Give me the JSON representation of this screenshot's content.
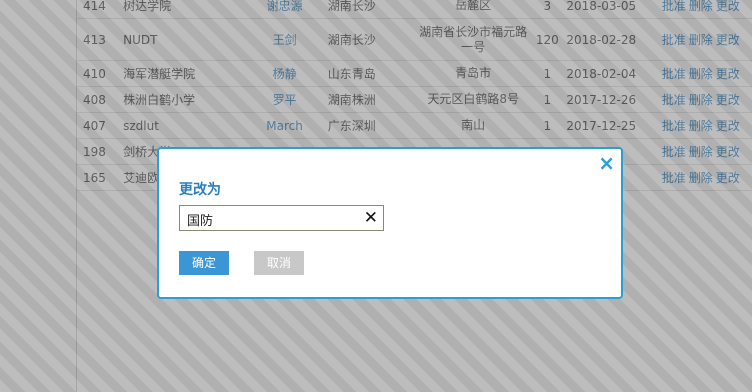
{
  "table": {
    "rows": [
      {
        "id": "414",
        "school": "树达学院",
        "name": "谢忠源",
        "city": "湖南长沙",
        "address": "岳麓区",
        "count": "3",
        "date": "2018-03-05"
      },
      {
        "id": "413",
        "school": "NUDT",
        "name": "王剑",
        "city": "湖南长沙",
        "address": "湖南省长沙市福元路一号",
        "count": "120",
        "date": "2018-02-28",
        "tall": true
      },
      {
        "id": "410",
        "school": "海军潜艇学院",
        "name": "杨静",
        "city": "山东青岛",
        "address": "青岛市",
        "count": "1",
        "date": "2018-02-04"
      },
      {
        "id": "408",
        "school": "株洲白鹤小学",
        "name": "罗平",
        "city": "湖南株洲",
        "address": "天元区白鹤路8号",
        "count": "1",
        "date": "2017-12-26"
      },
      {
        "id": "407",
        "school": "szdlut",
        "name": "March",
        "city": "广东深圳",
        "address": "南山",
        "count": "1",
        "date": "2017-12-25"
      },
      {
        "id": "198",
        "school": "剑桥大学",
        "name": "",
        "city": "",
        "address": "",
        "count": "",
        "date": "-01"
      },
      {
        "id": "165",
        "school": "艾迪欧南",
        "name": "",
        "city": "",
        "address": "",
        "count": "",
        "date": "-06"
      }
    ],
    "actions": {
      "approve": "批准",
      "delete": "删除",
      "edit": "更改"
    }
  },
  "dialog": {
    "close_icon": "×",
    "title": "更改为",
    "input_value": "国防",
    "clear_icon": "✕",
    "ok_label": "确定",
    "cancel_label": "取消"
  },
  "colors": {
    "accent": "#2a9fd4",
    "link": "#2b7ab6",
    "ok_button": "#3b96d6",
    "cancel_button": "#c8c8c8"
  }
}
